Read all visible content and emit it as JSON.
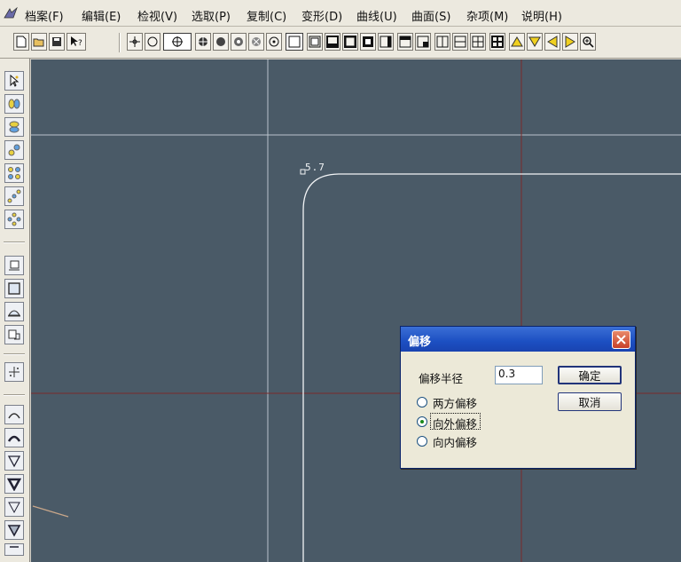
{
  "menu": {
    "items": [
      {
        "label": "档案(F)"
      },
      {
        "label": "编辑(E)"
      },
      {
        "label": "检视(V)"
      },
      {
        "label": "选取(P)"
      },
      {
        "label": "复制(C)"
      },
      {
        "label": "变形(D)"
      },
      {
        "label": "曲线(U)"
      },
      {
        "label": "曲面(S)"
      },
      {
        "label": "杂项(M)"
      },
      {
        "label": "说明(H)"
      }
    ]
  },
  "canvas": {
    "point_label": "5.7"
  },
  "dialog": {
    "title": "偏移",
    "radius_label": "偏移半径",
    "radius_value": "0.3",
    "ok_label": "确定",
    "cancel_label": "取消",
    "options": [
      {
        "label": "两方偏移",
        "selected": false
      },
      {
        "label": "向外偏移",
        "selected": true
      },
      {
        "label": "向内偏移",
        "selected": false
      }
    ]
  },
  "colors": {
    "canvas_bg": "#4a5a67",
    "grid_line": "#b9c3cc",
    "axis_line": "#7a2b2b",
    "title_bar": "#1c4fc2"
  }
}
